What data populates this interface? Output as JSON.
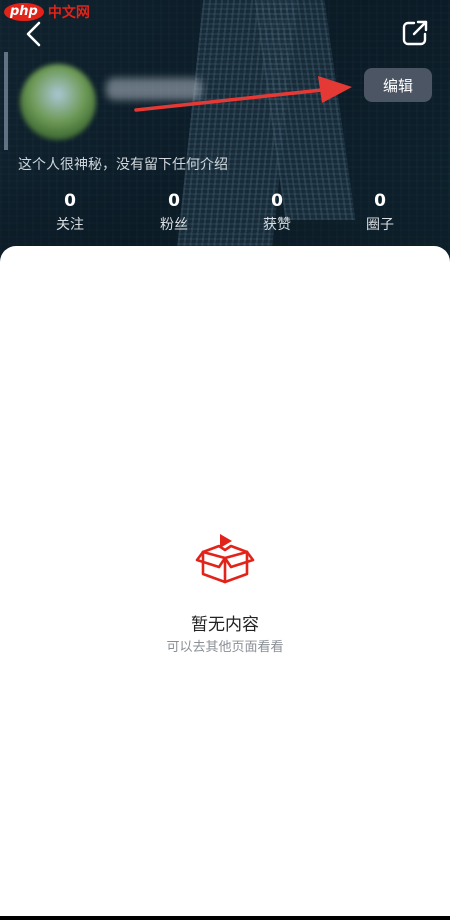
{
  "watermark": {
    "badge": "php",
    "text": "中文网"
  },
  "header": {
    "back_icon": "chevron-left-icon",
    "share_icon": "share-external-icon",
    "edit_button_label": "编辑"
  },
  "profile": {
    "bio": "这个人很神秘，没有留下任何介绍"
  },
  "stats": [
    {
      "value": "0",
      "label": "关注"
    },
    {
      "value": "0",
      "label": "粉丝"
    },
    {
      "value": "0",
      "label": "获赞"
    },
    {
      "value": "0",
      "label": "圈子"
    }
  ],
  "empty_state": {
    "icon": "empty-box-icon",
    "title": "暂无内容",
    "subtitle": "可以去其他页面看看"
  },
  "colors": {
    "accent_red": "#e2231a",
    "arrow_red": "#e53935",
    "edit_button_bg": "#4b5563"
  }
}
